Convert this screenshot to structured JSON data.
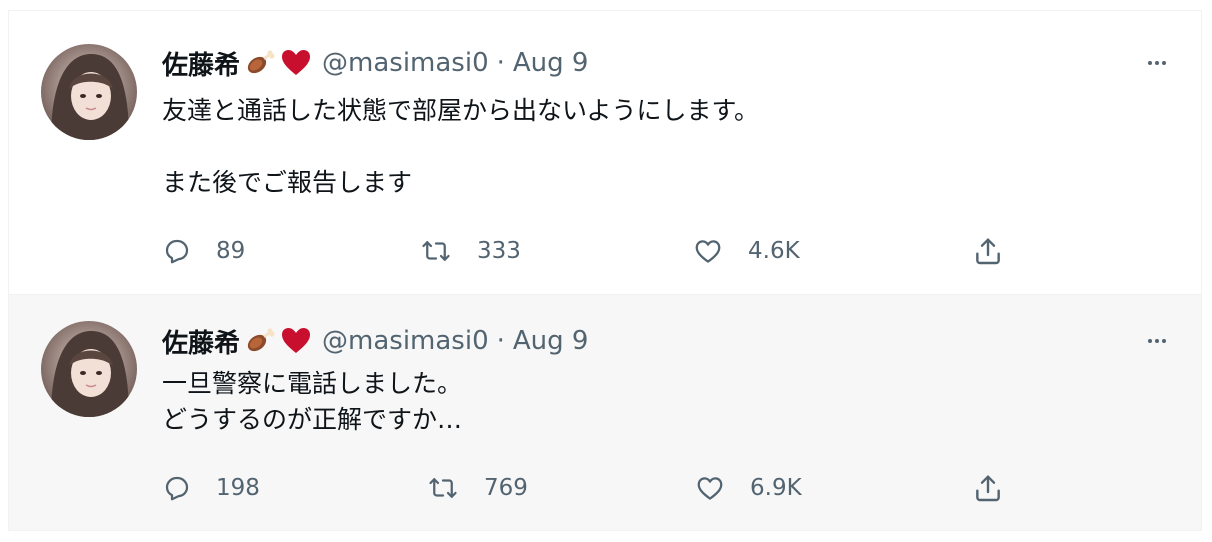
{
  "tweets": [
    {
      "display_name": "佐藤希",
      "emoji": [
        "meat-on-bone-emoji",
        "red-heart-emoji"
      ],
      "handle": "@masimasi0",
      "dot": "·",
      "date": "Aug 9",
      "text": "友達と通話した状態で部屋から出ないようにします。\n\nまた後でご報告します",
      "replies": "89",
      "retweets": "333",
      "likes": "4.6K"
    },
    {
      "display_name": "佐藤希",
      "emoji": [
        "meat-on-bone-emoji",
        "red-heart-emoji"
      ],
      "handle": "@masimasi0",
      "dot": "·",
      "date": "Aug 9",
      "text": "一旦警察に電話しました。\nどうするのが正解ですか…",
      "replies": "198",
      "retweets": "769",
      "likes": "6.9K"
    }
  ],
  "colors": {
    "text_primary": "#0f1419",
    "text_secondary": "#536471",
    "hover_background": "#f7f7f7",
    "heart_red": "#c8102e",
    "meat_brown": "#8b4a2b"
  }
}
